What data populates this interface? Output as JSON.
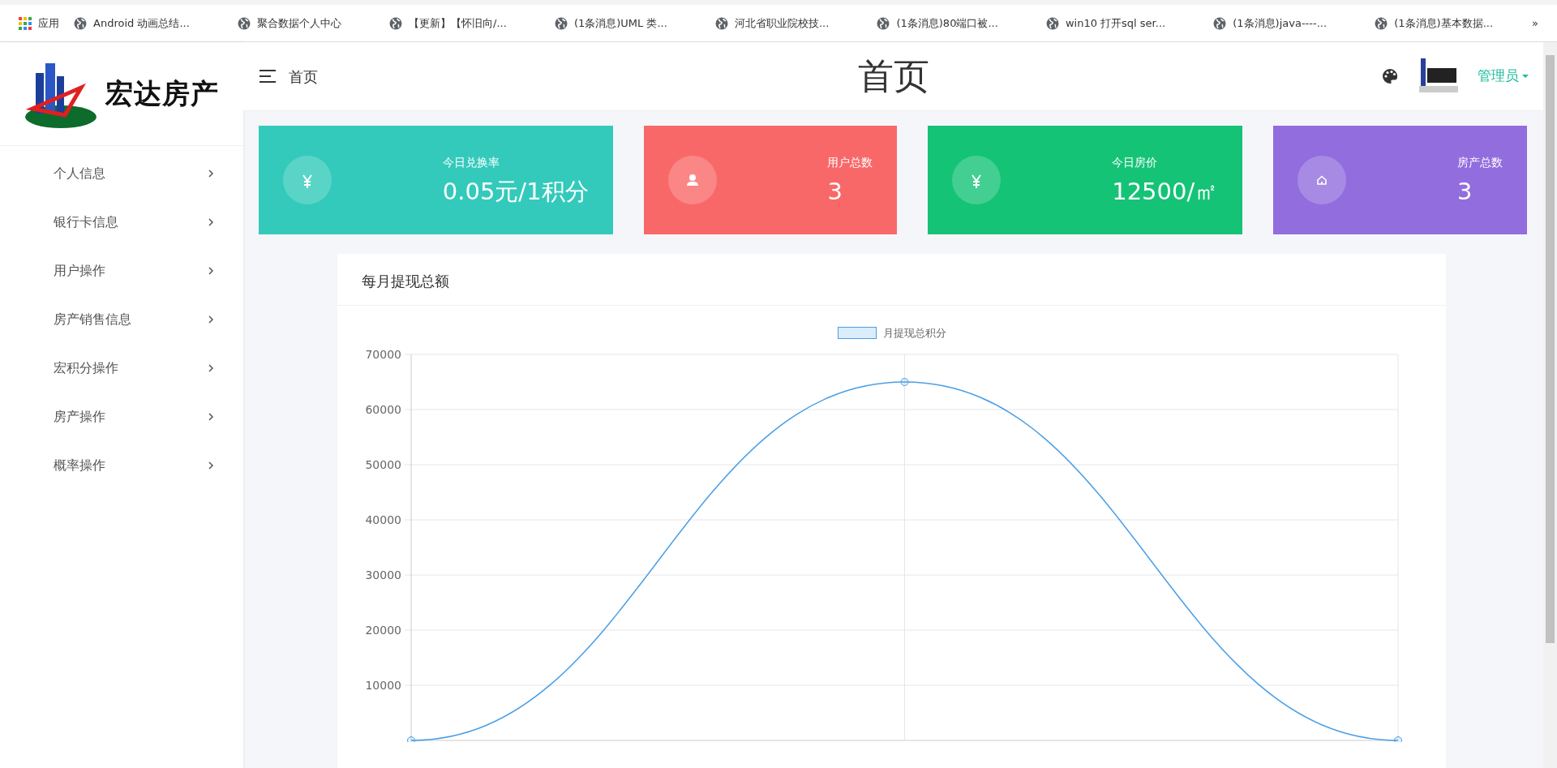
{
  "bookmarks_bar": {
    "apps_label": "应用",
    "bookmarks": [
      {
        "title": "Android 动画总结..."
      },
      {
        "title": "聚合数据个人中心"
      },
      {
        "title": "【更新】【怀旧向/..."
      },
      {
        "title": "(1条消息)UML 类..."
      },
      {
        "title": "河北省职业院校技..."
      },
      {
        "title": "(1条消息)80端口被..."
      },
      {
        "title": "win10 打开sql ser..."
      },
      {
        "title": "(1条消息)java----..."
      },
      {
        "title": "(1条消息)基本数据..."
      }
    ],
    "more": "»"
  },
  "logo": {
    "text": "宏达房产"
  },
  "sidebar": {
    "items": [
      {
        "label": "个人信息"
      },
      {
        "label": "银行卡信息"
      },
      {
        "label": "用户操作"
      },
      {
        "label": "房产销售信息"
      },
      {
        "label": "宏积分操作"
      },
      {
        "label": "房产操作"
      },
      {
        "label": "概率操作"
      }
    ]
  },
  "header": {
    "breadcrumb": "首页",
    "title": "首页",
    "user": "管理员"
  },
  "stat_cards": [
    {
      "kind": "yen",
      "label": "今日兑换率",
      "value": "0.05元/1积分",
      "color": "#33cabb"
    },
    {
      "kind": "user",
      "label": "用户总数",
      "value": "3",
      "color": "#f96868"
    },
    {
      "kind": "yen",
      "label": "今日房价",
      "value": "12500/㎡",
      "color": "#15c377"
    },
    {
      "kind": "home",
      "label": "房产总数",
      "value": "3",
      "color": "#926dde"
    }
  ],
  "chart_panel": {
    "title": "每月提现总额",
    "chart_data": {
      "type": "line",
      "grid": true,
      "ylim": [
        0,
        70000
      ],
      "yticks": [
        10000,
        20000,
        30000,
        40000,
        50000,
        60000,
        70000
      ],
      "series": [
        {
          "name": "月提现总积分",
          "color": "#4a9ee6",
          "marker": "circle",
          "values": [
            0,
            65000,
            0
          ]
        }
      ]
    }
  }
}
